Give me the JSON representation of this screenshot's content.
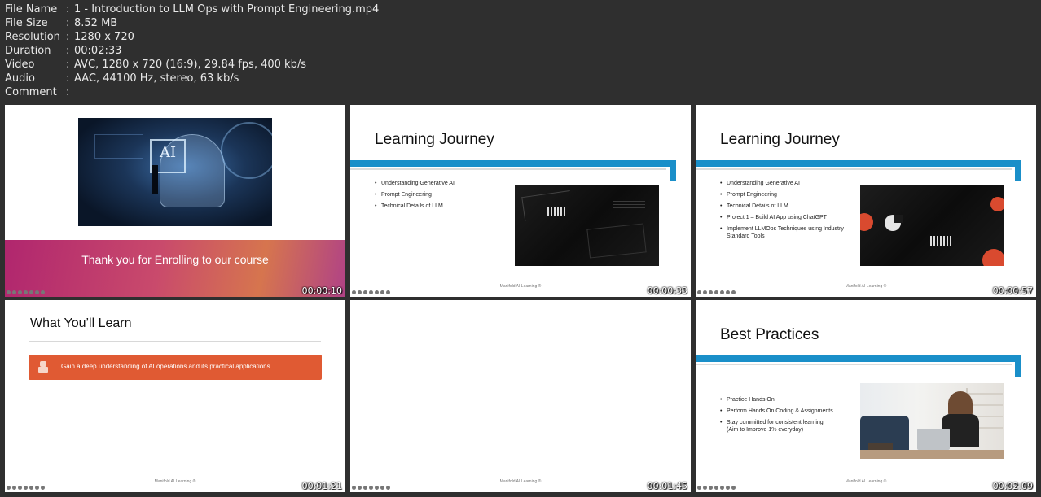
{
  "file_info": [
    {
      "key": "File Name",
      "value": "1 - Introduction to LLM Ops with Prompt Engineering.mp4"
    },
    {
      "key": "File Size",
      "value": "8.52 MB"
    },
    {
      "key": "Resolution",
      "value": "1280 x 720"
    },
    {
      "key": "Duration",
      "value": "00:02:33"
    },
    {
      "key": "Video",
      "value": "AVC, 1280 x 720 (16:9), 29.84 fps, 400 kb/s"
    },
    {
      "key": "Audio",
      "value": "AAC, 44100 Hz, stereo, 63 kb/s"
    },
    {
      "key": "Comment",
      "value": ""
    }
  ],
  "separator": ":",
  "footer_text": "Manifold AI Learning ®",
  "thumbs": [
    {
      "timestamp": "00:00:10",
      "banner_text": "Thank you for Enrolling to our course",
      "badge": "AI"
    },
    {
      "timestamp": "00:00:33",
      "title": "Learning Journey",
      "bullets": [
        "Understanding Generative AI",
        "Prompt Engineering",
        "Technical Details of LLM"
      ]
    },
    {
      "timestamp": "00:00:57",
      "title": "Learning Journey",
      "bullets": [
        "Understanding Generative AI",
        "Prompt Engineering",
        "Technical Details of LLM",
        "Project 1 – Build AI App using ChatGPT",
        "Implement LLMOps Techniques using Industry Standard Tools"
      ]
    },
    {
      "timestamp": "00:01:21",
      "title": "What You’ll Learn",
      "card_text": "Gain a deep understanding of AI operations and its practical applications."
    },
    {
      "timestamp": "00:01:45"
    },
    {
      "timestamp": "00:02:09",
      "title": "Best Practices",
      "bullets": [
        "Practice Hands On",
        "Perform Hands On Coding & Assignments",
        "Stay committed for consistent learning (Aim to Improve 1% everyday)"
      ]
    }
  ]
}
